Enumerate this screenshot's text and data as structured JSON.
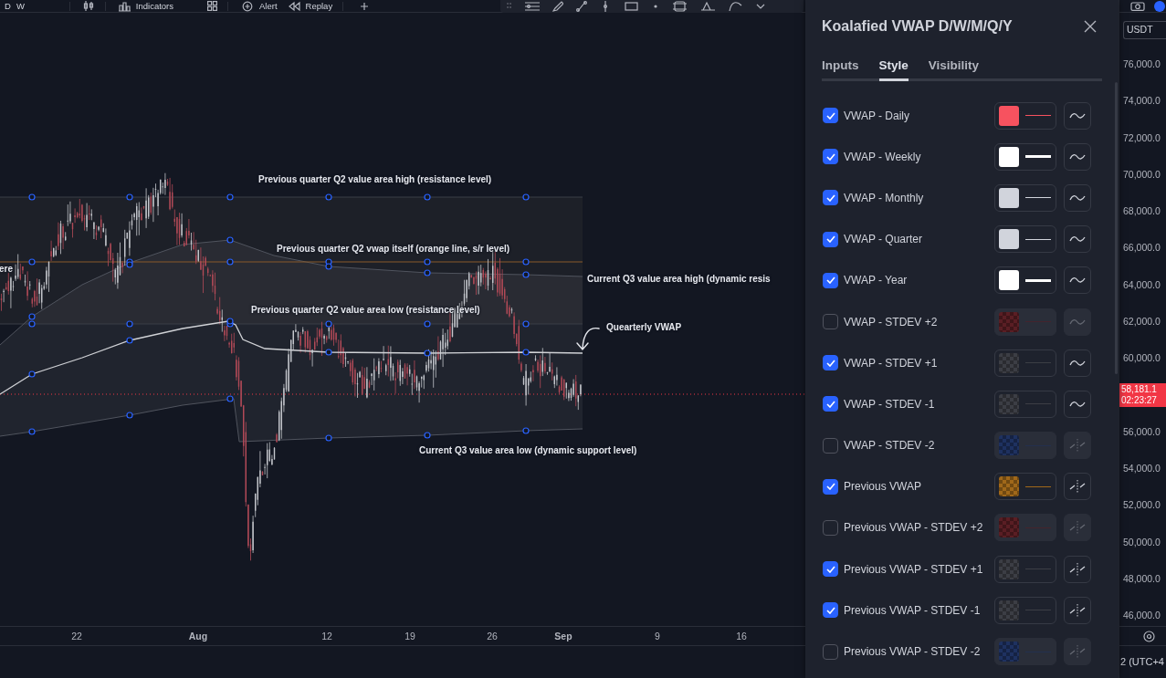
{
  "top_toolbar": {
    "intervals": [
      "D",
      "W"
    ],
    "buttons": [
      "Indicators",
      "Alert",
      "Replay"
    ]
  },
  "chart": {
    "annotations": [
      "Previous quarter Q2 value area high (resistance level)",
      "Previous quarter Q2 vwap itself (orange line, s/r level)",
      "ere",
      "Current Q3 value area high (dynamic resis",
      "Previous quarter Q2 value area low (resistance level)",
      "Quearterly VWAP",
      "Current Q3 value area low (dynamic support level)"
    ]
  },
  "time_axis": {
    "labels": [
      {
        "text": "22",
        "kind": "day"
      },
      {
        "text": "Aug",
        "kind": "month"
      },
      {
        "text": "12",
        "kind": "day"
      },
      {
        "text": "19",
        "kind": "day"
      },
      {
        "text": "26",
        "kind": "day"
      },
      {
        "text": "Sep",
        "kind": "month"
      },
      {
        "text": "9",
        "kind": "day"
      },
      {
        "text": "16",
        "kind": "day"
      }
    ]
  },
  "indicator_settings": {
    "title": "Koalafied VWAP D/W/M/Q/Y",
    "tabs": [
      {
        "label": "Inputs",
        "selected": false
      },
      {
        "label": "Style",
        "selected": true
      },
      {
        "label": "Visibility",
        "selected": false
      }
    ],
    "rows": [
      {
        "kind": "line",
        "label": "VWAP - Daily",
        "checked": true,
        "color": "#f7525f",
        "transparent": false,
        "thick_line": false
      },
      {
        "kind": "line",
        "label": "VWAP - Weekly",
        "checked": true,
        "color": "#ffffff",
        "transparent": false,
        "thick_line": true
      },
      {
        "kind": "line",
        "label": "VWAP - Monthly",
        "checked": true,
        "color": "#d1d4dc",
        "transparent": false,
        "thick_line": false
      },
      {
        "kind": "line",
        "label": "VWAP - Quarter",
        "checked": true,
        "color": "#d1d4dc",
        "transparent": false,
        "thick_line": false
      },
      {
        "kind": "line",
        "label": "VWAP - Year",
        "checked": true,
        "color": "#ffffff",
        "transparent": false,
        "thick_line": true
      },
      {
        "kind": "line",
        "label": "VWAP - STDEV +2",
        "checked": false,
        "color": "#5a1e24",
        "transparent": true,
        "thick_line": false
      },
      {
        "kind": "line",
        "label": "VWAP - STDEV +1",
        "checked": true,
        "color": "#3c3e45",
        "transparent": true,
        "thick_line": false
      },
      {
        "kind": "line",
        "label": "VWAP - STDEV -1",
        "checked": true,
        "color": "#3c3e45",
        "transparent": true,
        "thick_line": false
      },
      {
        "kind": "line_breaks",
        "label": "VWAP - STDEV -2",
        "checked": false,
        "color": "#1e3160",
        "transparent": true,
        "thick_line": false
      },
      {
        "kind": "line_breaks",
        "label": "Previous VWAP",
        "checked": true,
        "color": "#a0681a",
        "transparent": true,
        "thick_line": false
      },
      {
        "kind": "line_breaks",
        "label": "Previous VWAP - STDEV +2",
        "checked": false,
        "color": "#5a1e24",
        "transparent": true,
        "thick_line": false
      },
      {
        "kind": "line_breaks",
        "label": "Previous VWAP - STDEV +1",
        "checked": true,
        "color": "#3c3e45",
        "transparent": true,
        "thick_line": false
      },
      {
        "kind": "line_breaks",
        "label": "Previous VWAP - STDEV -1",
        "checked": true,
        "color": "#3c3e45",
        "transparent": true,
        "thick_line": false
      },
      {
        "kind": "line_breaks",
        "label": "Previous VWAP - STDEV -2",
        "checked": false,
        "color": "#1e3160",
        "transparent": true,
        "thick_line": false
      }
    ]
  },
  "price_axis": {
    "currency": "USDT",
    "labels": [
      {
        "kind": "tick",
        "text": "76,000.0"
      },
      {
        "kind": "tick",
        "text": "74,000.0"
      },
      {
        "kind": "tick",
        "text": "72,000.0"
      },
      {
        "kind": "tick",
        "text": "70,000.0"
      },
      {
        "kind": "tick",
        "text": "68,000.0"
      },
      {
        "kind": "tick",
        "text": "66,000.0"
      },
      {
        "kind": "tick",
        "text": "64,000.0"
      },
      {
        "kind": "tick",
        "text": "62,000.0"
      },
      {
        "kind": "tick",
        "text": "60,000.0"
      },
      {
        "kind": "last_price",
        "text": "58,181.1",
        "countdown": "02:23:27"
      },
      {
        "kind": "tick",
        "text": "56,000.0"
      },
      {
        "kind": "tick",
        "text": "54,000.0"
      },
      {
        "kind": "tick",
        "text": "52,000.0"
      },
      {
        "kind": "tick",
        "text": "50,000.0"
      },
      {
        "kind": "tick",
        "text": "48,000.0"
      },
      {
        "kind": "tick",
        "text": "46,000.0"
      }
    ]
  },
  "status_bar": {
    "timezone": "2 (UTC+4"
  }
}
